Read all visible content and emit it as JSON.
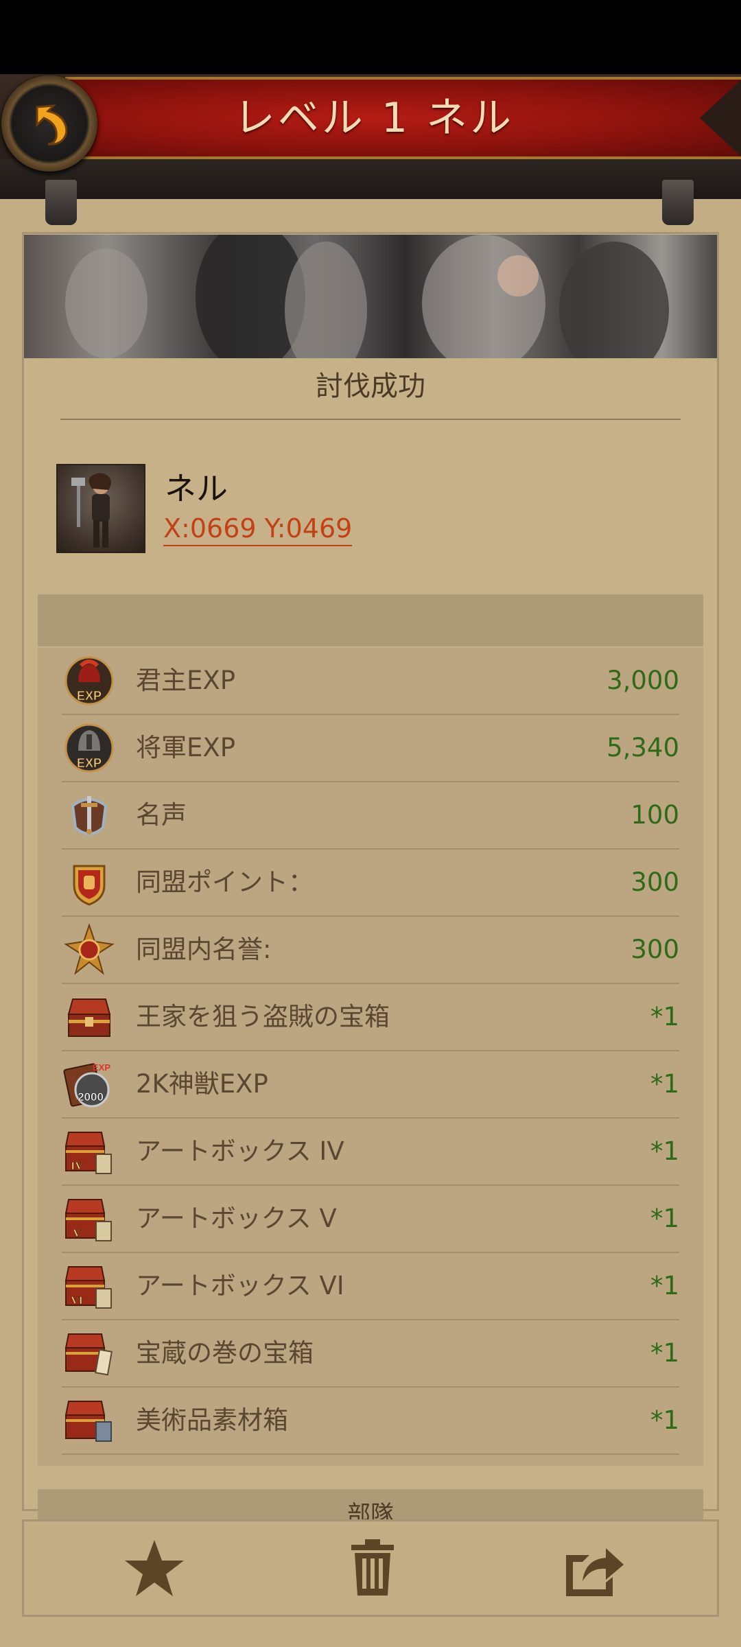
{
  "header": {
    "title": "レベル 1 ネル",
    "back_icon": "back-arrow-icon"
  },
  "report": {
    "subtitle": "討伐成功",
    "target_name": "ネル",
    "coords": "X:0669 Y:0469"
  },
  "rewards": [
    {
      "icon": "lord-exp-icon",
      "label": "君主EXP",
      "value": "3,000"
    },
    {
      "icon": "general-exp-icon",
      "label": "将軍EXP",
      "value": "5,340"
    },
    {
      "icon": "fame-icon",
      "label": "名声",
      "value": "100"
    },
    {
      "icon": "alliance-point-icon",
      "label": "同盟ポイント：",
      "value": "300"
    },
    {
      "icon": "alliance-honor-icon",
      "label": "同盟内名誉:",
      "value": "300"
    },
    {
      "icon": "bandit-chest-icon",
      "label": "王家を狙う盗賊の宝箱",
      "value": "*1"
    },
    {
      "icon": "beast-exp-2000-icon",
      "label": "2K神獣EXP",
      "value": "*1"
    },
    {
      "icon": "art-box-iv-icon",
      "label": "アートボックス IV",
      "value": "*1"
    },
    {
      "icon": "art-box-v-icon",
      "label": "アートボックス V",
      "value": "*1"
    },
    {
      "icon": "art-box-vi-icon",
      "label": "アートボックス VI",
      "value": "*1"
    },
    {
      "icon": "treasure-scroll-chest-icon",
      "label": "宝蔵の巻の宝箱",
      "value": "*1"
    },
    {
      "icon": "art-material-box-icon",
      "label": "美術品素材箱",
      "value": "*1"
    }
  ],
  "icon_badges": {
    "exp": "EXP",
    "beast": "2000",
    "iv": "IV",
    "v": "V",
    "vi": "VI"
  },
  "next_section": {
    "label": "部隊"
  },
  "footer": {
    "favorite_icon": "star-icon",
    "delete_icon": "trash-icon",
    "share_icon": "share-icon"
  },
  "colors": {
    "value_green": "#2e6a18",
    "coords_orange": "#c44015",
    "banner_red": "#a3160f",
    "panel_bg": "#c7b189"
  }
}
